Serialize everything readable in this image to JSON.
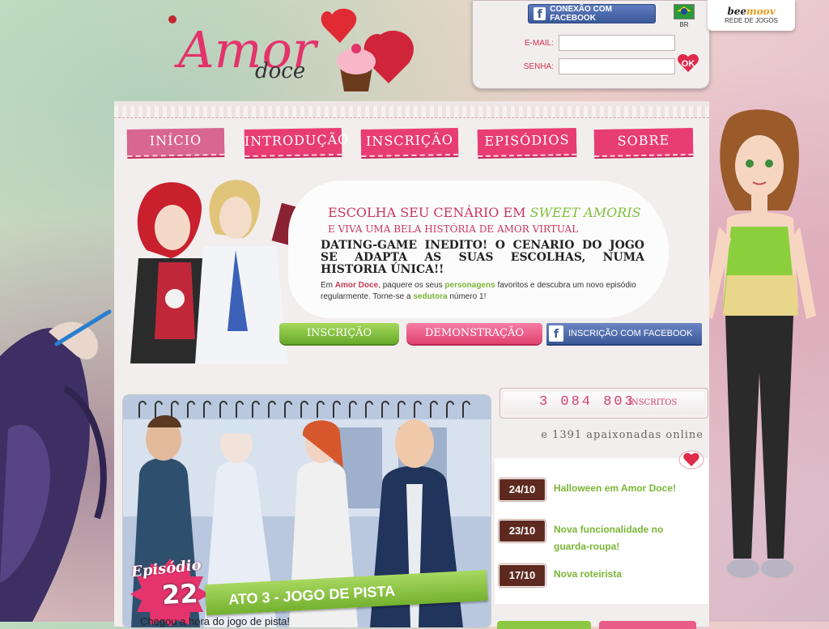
{
  "header": {
    "logo_title": "Amor",
    "logo_sub": "doce",
    "fb_connect": "CONEXÃO COM FACEBOOK",
    "email_label": "E-MAIL:",
    "password_label": "SENHA:",
    "email_value": "",
    "password_value": "",
    "ok_label": "OK",
    "flag_label": "BR",
    "network_brand_a": "bee",
    "network_brand_b": "moov",
    "network_label": "REDE DE JOGOS"
  },
  "nav": [
    {
      "label": "INÍCIO"
    },
    {
      "label": "INTRODUÇÃO"
    },
    {
      "label": "INSCRIÇÃO"
    },
    {
      "label": "EPISÓDIOS"
    },
    {
      "label": "SOBRE"
    }
  ],
  "intro": {
    "title_a": "ESCOLHA SEU CENÁRIO EM ",
    "title_b": "SWEET AMORIS",
    "subtitle": "E VIVA UMA BELA HISTÓRIA DE AMOR VIRTUAL",
    "headline": "DATING-GAME INEDITO! O CENARIO DO JOGO SE ADAPTA AS SUAS ESCOLHAS, NUMA HISTORIA ÚNICA!!",
    "text_1": "Em ",
    "text_2": "Amor Doce",
    "text_3": ", paquere os seus ",
    "text_4": "personagens",
    "text_5": " favoritos e descubra um novo episódio regularmente. Torne-se a ",
    "text_6": "sedutora",
    "text_7": " número 1!"
  },
  "cta": {
    "signup": "INSCRIÇÃO",
    "demo": "DEMONSTRAÇÃO",
    "fb_signup": "INSCRIÇÃO COM FACEBOOK"
  },
  "episode": {
    "label": "Episódio",
    "number": "22",
    "title": "ATO 3 - JOGO DE PISTA",
    "caption": "Chegou a hora do jogo de pista!"
  },
  "stats": {
    "count": "3 084 803",
    "count_label": "INSCRITOS",
    "online": "e 1391 apaixonadas online"
  },
  "news": [
    {
      "date": "24/10",
      "text": "Halloween em Amor Doce!"
    },
    {
      "date": "23/10",
      "text": "Nova funcionalidade no guarda-roupa!"
    },
    {
      "date": "17/10",
      "text": "Nova roteirista"
    }
  ],
  "colors": {
    "brand_pink": "#e83d73",
    "accent_green": "#7ab535",
    "facebook_blue": "#3b5998"
  }
}
